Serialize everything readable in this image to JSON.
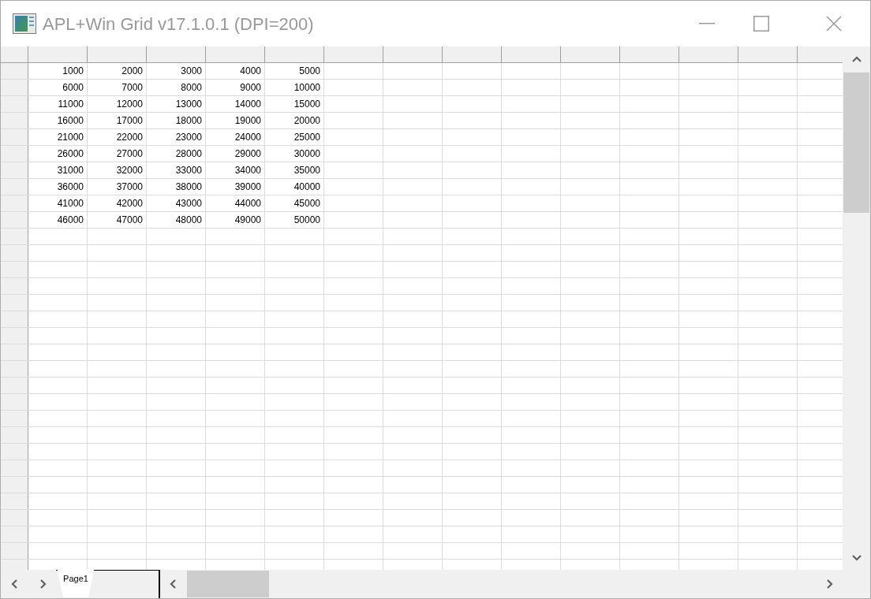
{
  "window": {
    "title": "APL+Win Grid v17.1.0.1 (DPI=200)"
  },
  "grid": {
    "rows": [
      [
        "1000",
        "2000",
        "3000",
        "4000",
        "5000"
      ],
      [
        "6000",
        "7000",
        "8000",
        "9000",
        "10000"
      ],
      [
        "11000",
        "12000",
        "13000",
        "14000",
        "15000"
      ],
      [
        "16000",
        "17000",
        "18000",
        "19000",
        "20000"
      ],
      [
        "21000",
        "22000",
        "23000",
        "24000",
        "25000"
      ],
      [
        "26000",
        "27000",
        "28000",
        "29000",
        "30000"
      ],
      [
        "31000",
        "32000",
        "33000",
        "34000",
        "35000"
      ],
      [
        "36000",
        "37000",
        "38000",
        "39000",
        "40000"
      ],
      [
        "41000",
        "42000",
        "43000",
        "44000",
        "45000"
      ],
      [
        "46000",
        "47000",
        "48000",
        "49000",
        "50000"
      ]
    ]
  },
  "sheet_tabs": [
    {
      "label": "Page1",
      "selected": true
    }
  ]
}
